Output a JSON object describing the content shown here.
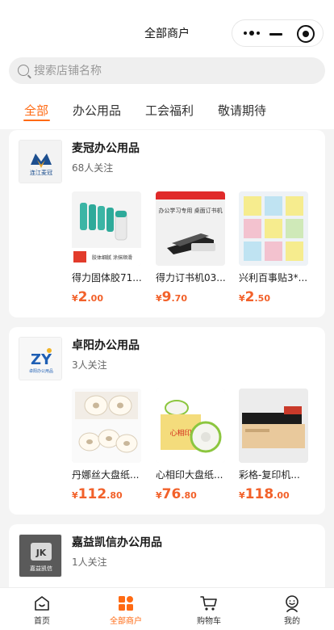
{
  "nav": {
    "title": "全部商户"
  },
  "search": {
    "placeholder": "搜索店铺名称"
  },
  "tabs": [
    {
      "label": "全部",
      "active": true
    },
    {
      "label": "办公用品",
      "active": false
    },
    {
      "label": "工会福利",
      "active": false
    },
    {
      "label": "敬请期待",
      "active": false
    }
  ],
  "shops": [
    {
      "name": "麦冠办公用品",
      "followers": "68人关注",
      "logo_text": "连江麦冠",
      "products": [
        {
          "name": "得力固体胶71...",
          "price_int": "2",
          "price_dec": ".00",
          "currency": "¥",
          "image_text": "胶体细腻 涂抹顺滑"
        },
        {
          "name": "得力订书机03...",
          "price_int": "9",
          "price_dec": ".70",
          "currency": "¥",
          "image_text": "办公学习专用 桌面订书机"
        },
        {
          "name": "兴利百事贴3*...",
          "price_int": "2",
          "price_dec": ".50",
          "currency": "¥",
          "image_text": ""
        }
      ]
    },
    {
      "name": "卓阳办公用品",
      "followers": "3人关注",
      "logo_text": "卓阳办公用品",
      "products": [
        {
          "name": "丹娜丝大盘纸...",
          "price_int": "112",
          "price_dec": ".80",
          "currency": "¥",
          "image_text": ""
        },
        {
          "name": "心相印大盘纸...",
          "price_int": "76",
          "price_dec": ".80",
          "currency": "¥",
          "image_text": "心相印"
        },
        {
          "name": "彩格-复印机...",
          "price_int": "118",
          "price_dec": ".00",
          "currency": "¥",
          "image_text": ""
        }
      ]
    },
    {
      "name": "嘉益凯信办公用品",
      "followers": "1人关注",
      "logo_text": "嘉益凯信",
      "products": []
    }
  ],
  "tabbar": [
    {
      "label": "首页",
      "icon": "home-icon",
      "active": false
    },
    {
      "label": "全部商户",
      "icon": "grid-icon",
      "active": true
    },
    {
      "label": "购物车",
      "icon": "cart-icon",
      "active": false
    },
    {
      "label": "我的",
      "icon": "user-icon",
      "active": false
    }
  ],
  "colors": {
    "accent": "#ff6a13",
    "price": "#f2612a",
    "background": "#f4f4f4"
  }
}
